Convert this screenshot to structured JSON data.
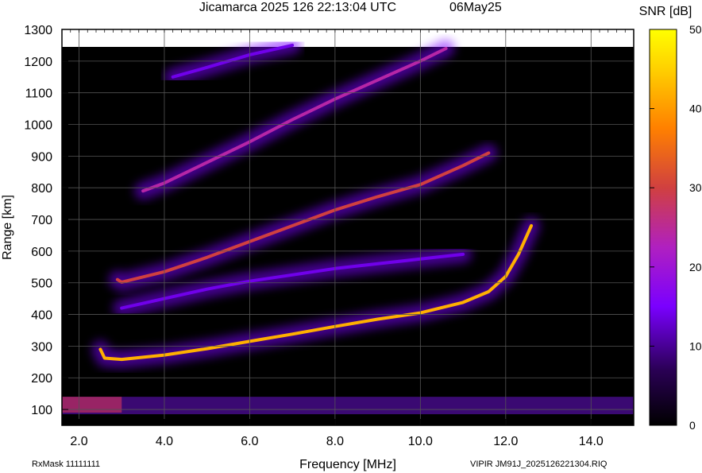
{
  "header": {
    "title": "Jicamarca 2025 126 22:13:04 UTC",
    "date": "06May25"
  },
  "colorbar": {
    "title": "SNR [dB]",
    "ticks": [
      "50",
      "40",
      "30",
      "20",
      "10",
      "0"
    ]
  },
  "footer": {
    "left": "RxMask 11111111",
    "right": "VIPIR  JM91J_2025126221304.RIQ"
  },
  "colors": {
    "background": "#000000",
    "grid": "#555555",
    "scale": [
      "#000000",
      "#2a0055",
      "#7a00ff",
      "#b020c0",
      "#d04040",
      "#ff8000",
      "#ffd000",
      "#ffff00"
    ]
  },
  "chart_data": {
    "type": "heatmap",
    "title": "Jicamarca 2025 126 22:13:04 UTC",
    "xlabel": "Frequency [MHz]",
    "ylabel": "Range [km]",
    "colorbar_label": "SNR [dB]",
    "xlim": [
      1.6,
      15.0
    ],
    "ylim": [
      50,
      1300
    ],
    "clim": [
      0,
      50
    ],
    "x_ticks": [
      "2.0",
      "4.0",
      "6.0",
      "8.0",
      "10.0",
      "12.0",
      "14.0"
    ],
    "y_ticks": [
      "100",
      "200",
      "300",
      "400",
      "500",
      "600",
      "700",
      "800",
      "900",
      "1000",
      "1100",
      "1200",
      "1300"
    ],
    "grid": true,
    "traces": [
      {
        "x": [
          2.5,
          2.6,
          3.0,
          4.0,
          5.0,
          6.0,
          7.0,
          8.0,
          9.0,
          10.0,
          11.0,
          11.6,
          12.0,
          12.3,
          12.6
        ],
        "y": [
          290,
          262,
          258,
          272,
          292,
          315,
          338,
          362,
          385,
          405,
          438,
          472,
          520,
          590,
          680
        ],
        "snr": 42
      },
      {
        "x": [
          2.9,
          3.0,
          4.0,
          5.0,
          6.0,
          7.0,
          8.0,
          9.0,
          10.0,
          11.0,
          11.6
        ],
        "y": [
          510,
          502,
          535,
          580,
          630,
          680,
          730,
          772,
          810,
          870,
          910
        ],
        "snr": 30
      },
      {
        "x": [
          3.0,
          4.0,
          5.0,
          6.0,
          7.0,
          8.0,
          9.0,
          10.0,
          11.0
        ],
        "y": [
          420,
          450,
          480,
          505,
          525,
          545,
          560,
          575,
          590
        ],
        "snr": 14
      },
      {
        "x": [
          3.5,
          4.0,
          5.0,
          6.0,
          7.0,
          8.0,
          9.0,
          10.0,
          10.6
        ],
        "y": [
          790,
          815,
          880,
          945,
          1015,
          1080,
          1140,
          1200,
          1240
        ],
        "snr": 24
      },
      {
        "x": [
          4.2,
          5.0,
          6.0,
          7.0
        ],
        "y": [
          1150,
          1180,
          1220,
          1250
        ],
        "snr": 14
      }
    ]
  }
}
